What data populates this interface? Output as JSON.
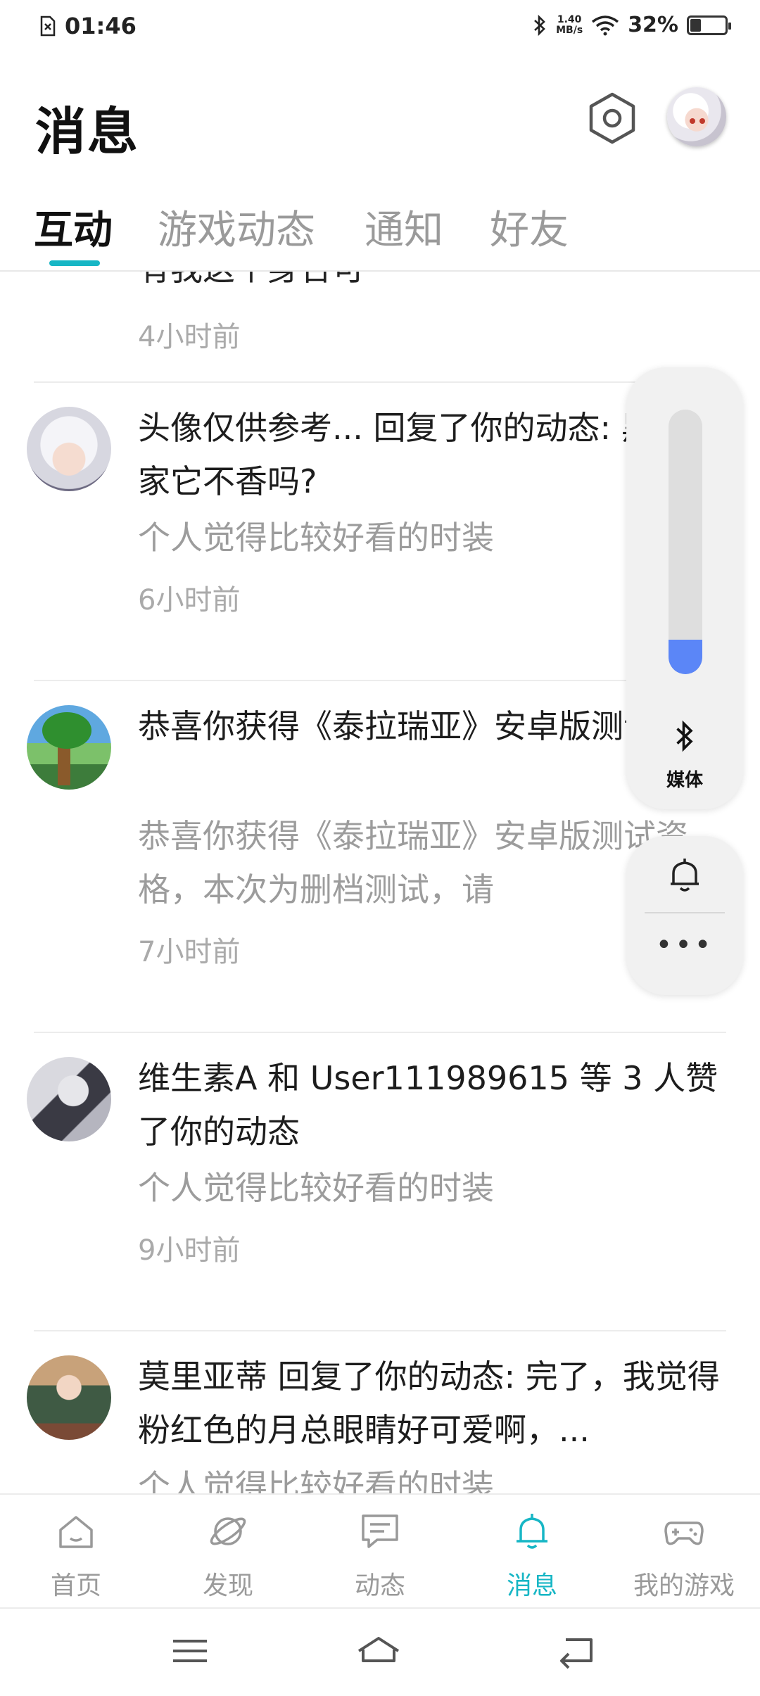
{
  "status_bar": {
    "time": "01:46",
    "net_speed_value": "1.40",
    "net_speed_unit": "MB/s",
    "battery_percent": "32%",
    "battery_level": 0.32
  },
  "header": {
    "title": "消息"
  },
  "tabs": [
    {
      "label": "互动",
      "active": true
    },
    {
      "label": "游戏动态",
      "active": false
    },
    {
      "label": "通知",
      "active": false
    },
    {
      "label": "好友",
      "active": false
    }
  ],
  "feed": {
    "clipped_top_text": "有我这个身合可",
    "first_time": "4小时前",
    "items": [
      {
        "title": "头像仅供参考... 回复了你的动态: 黑艺术家它不香吗?",
        "subtitle": "个人觉得比较好看的时装",
        "time": "6小时前"
      },
      {
        "title": "恭喜你获得《泰拉瑞亚》安卓版测试资格",
        "subtitle": "恭喜你获得《泰拉瑞亚》安卓版测试资格，本次为删档测试，请",
        "time": "7小时前"
      },
      {
        "title": "维生素A 和 User111989615 等 3 人赞了你的动态",
        "subtitle": "个人觉得比较好看的时装",
        "time": "9小时前"
      },
      {
        "title": "莫里亚蒂 回复了你的动态: 完了，我觉得粉红色的月总眼睛好可爱啊，...",
        "subtitle": "个人觉得比较好看的时装",
        "time": ""
      }
    ]
  },
  "volume_overlay": {
    "level": 0.13,
    "bluetooth_label": "媒体"
  },
  "bottom_nav": [
    {
      "label": "首页",
      "icon": "home-icon",
      "active": false
    },
    {
      "label": "发现",
      "icon": "planet-icon",
      "active": false
    },
    {
      "label": "动态",
      "icon": "chat-icon",
      "active": false
    },
    {
      "label": "消息",
      "icon": "bell-icon",
      "active": true
    },
    {
      "label": "我的游戏",
      "icon": "gamepad-icon",
      "active": false
    }
  ],
  "colors": {
    "accent": "#17b6c5",
    "volume_fill": "#5b86f7"
  }
}
